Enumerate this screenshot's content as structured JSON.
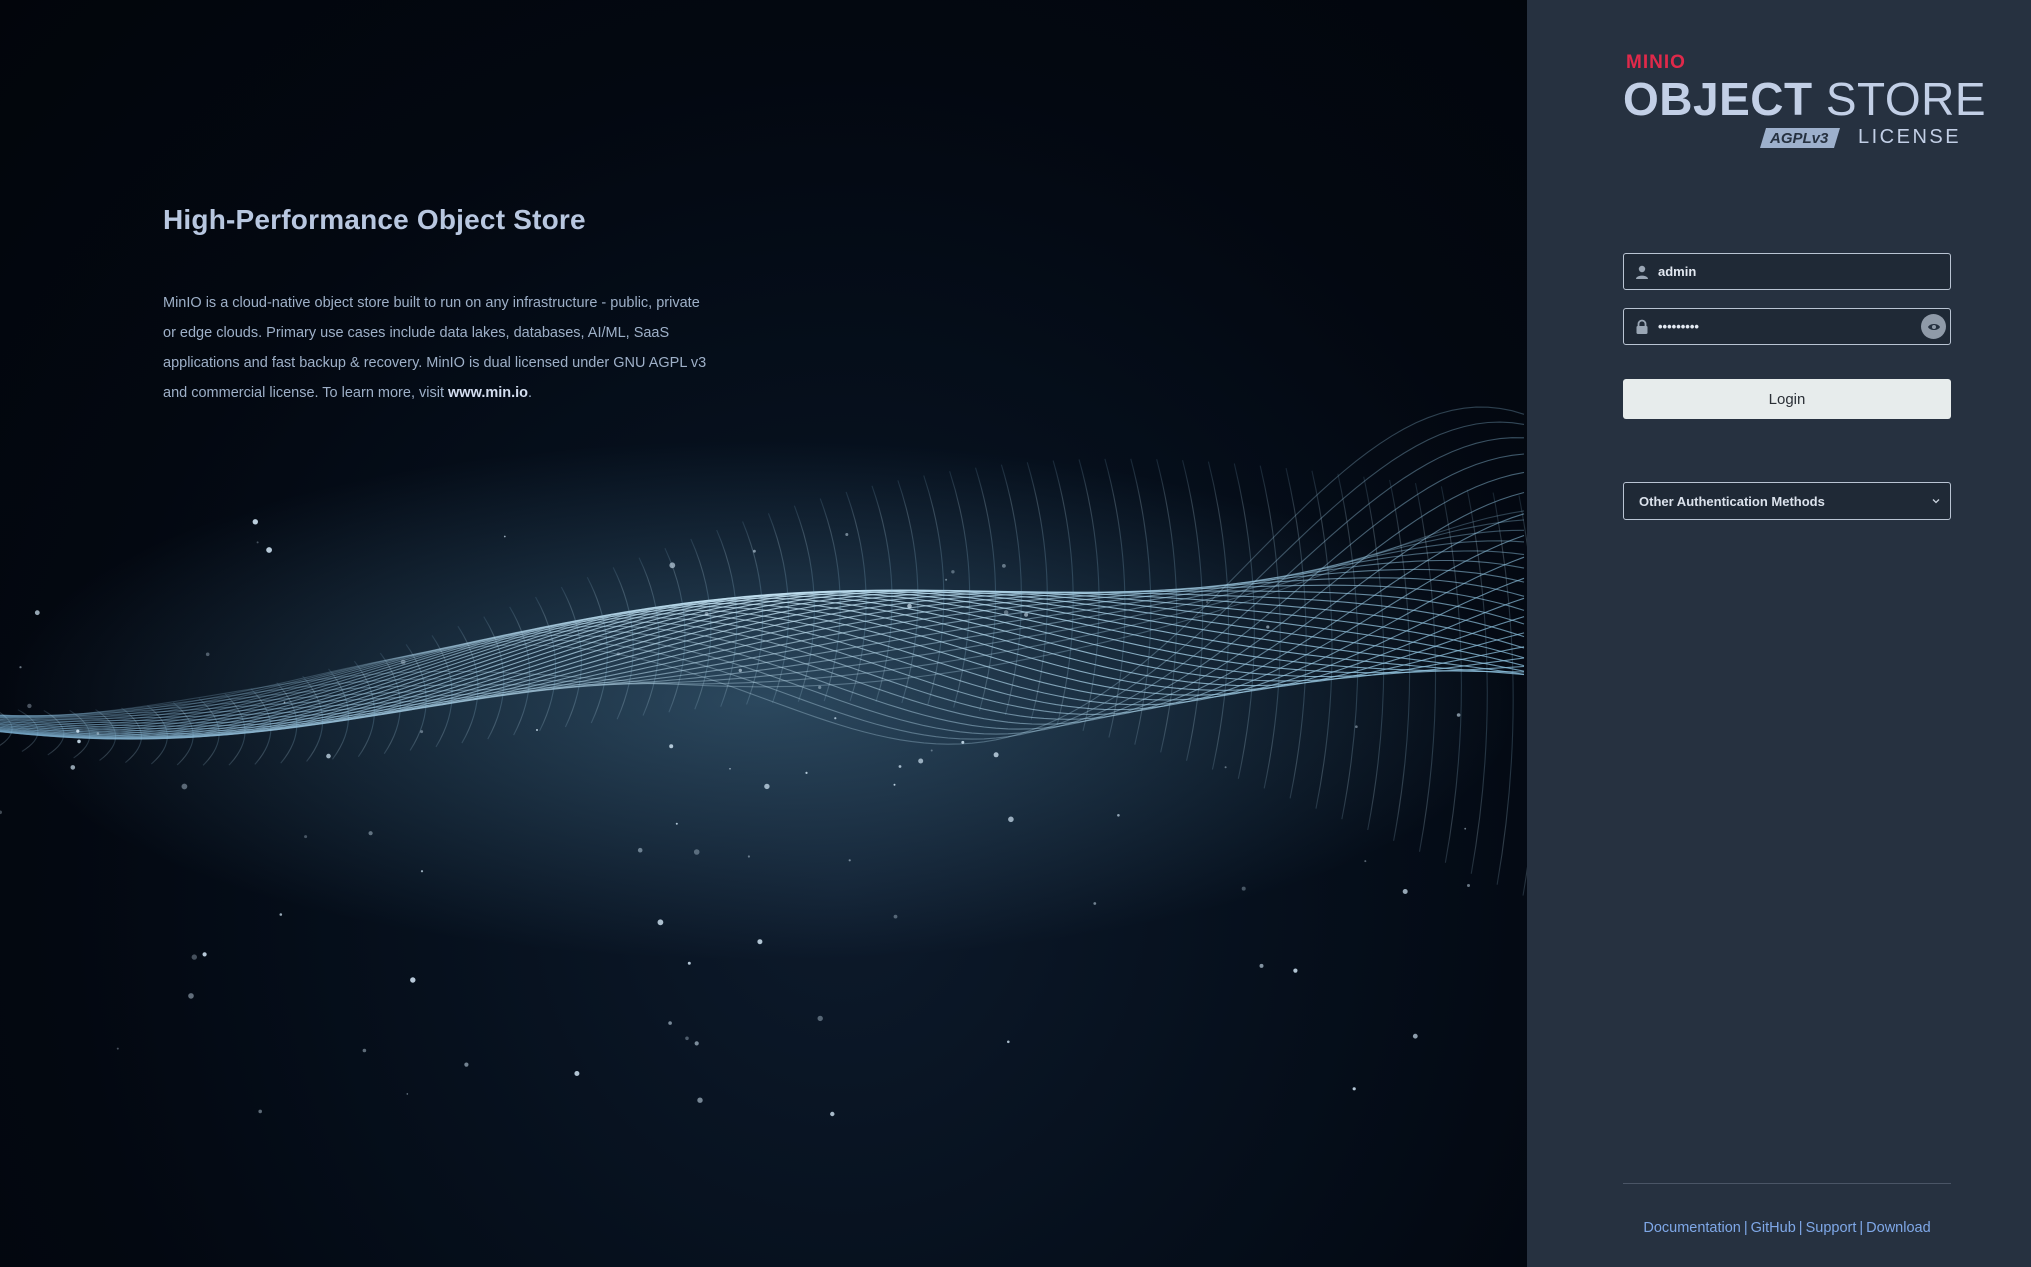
{
  "hero": {
    "title": "High-Performance Object Store",
    "description_prefix": "MinIO is a cloud-native object store built to run on any infrastructure - public, private or edge clouds. Primary use cases include data lakes, databases, AI/ML, SaaS applications and fast backup & recovery. MinIO is dual licensed under GNU AGPL v3 and commercial license. To learn more, visit ",
    "description_link": "www.min.io",
    "description_suffix": "."
  },
  "logo": {
    "brand": "MINIO",
    "product_bold": "OBJECT",
    "product_light": " STORE",
    "badge": "AGPLv3",
    "license": "LICENSE",
    "brand_color": "#e0294a"
  },
  "login": {
    "username_value": "admin",
    "username_icon": "user-icon",
    "password_value": "minio1234",
    "password_icon": "lock-icon",
    "show_password_icon": "eye-icon",
    "submit_label": "Login",
    "other_methods_label": "Other Authentication Methods",
    "other_methods_icon": "chevron-down-icon"
  },
  "footer": {
    "links": [
      "Documentation",
      "GitHub",
      "Support",
      "Download"
    ],
    "separator": "|",
    "link_color": "#7fa8e8"
  },
  "colors": {
    "panel_bg": "#263140",
    "hero_bg": "#030811",
    "wave": "#a9d4ec"
  }
}
